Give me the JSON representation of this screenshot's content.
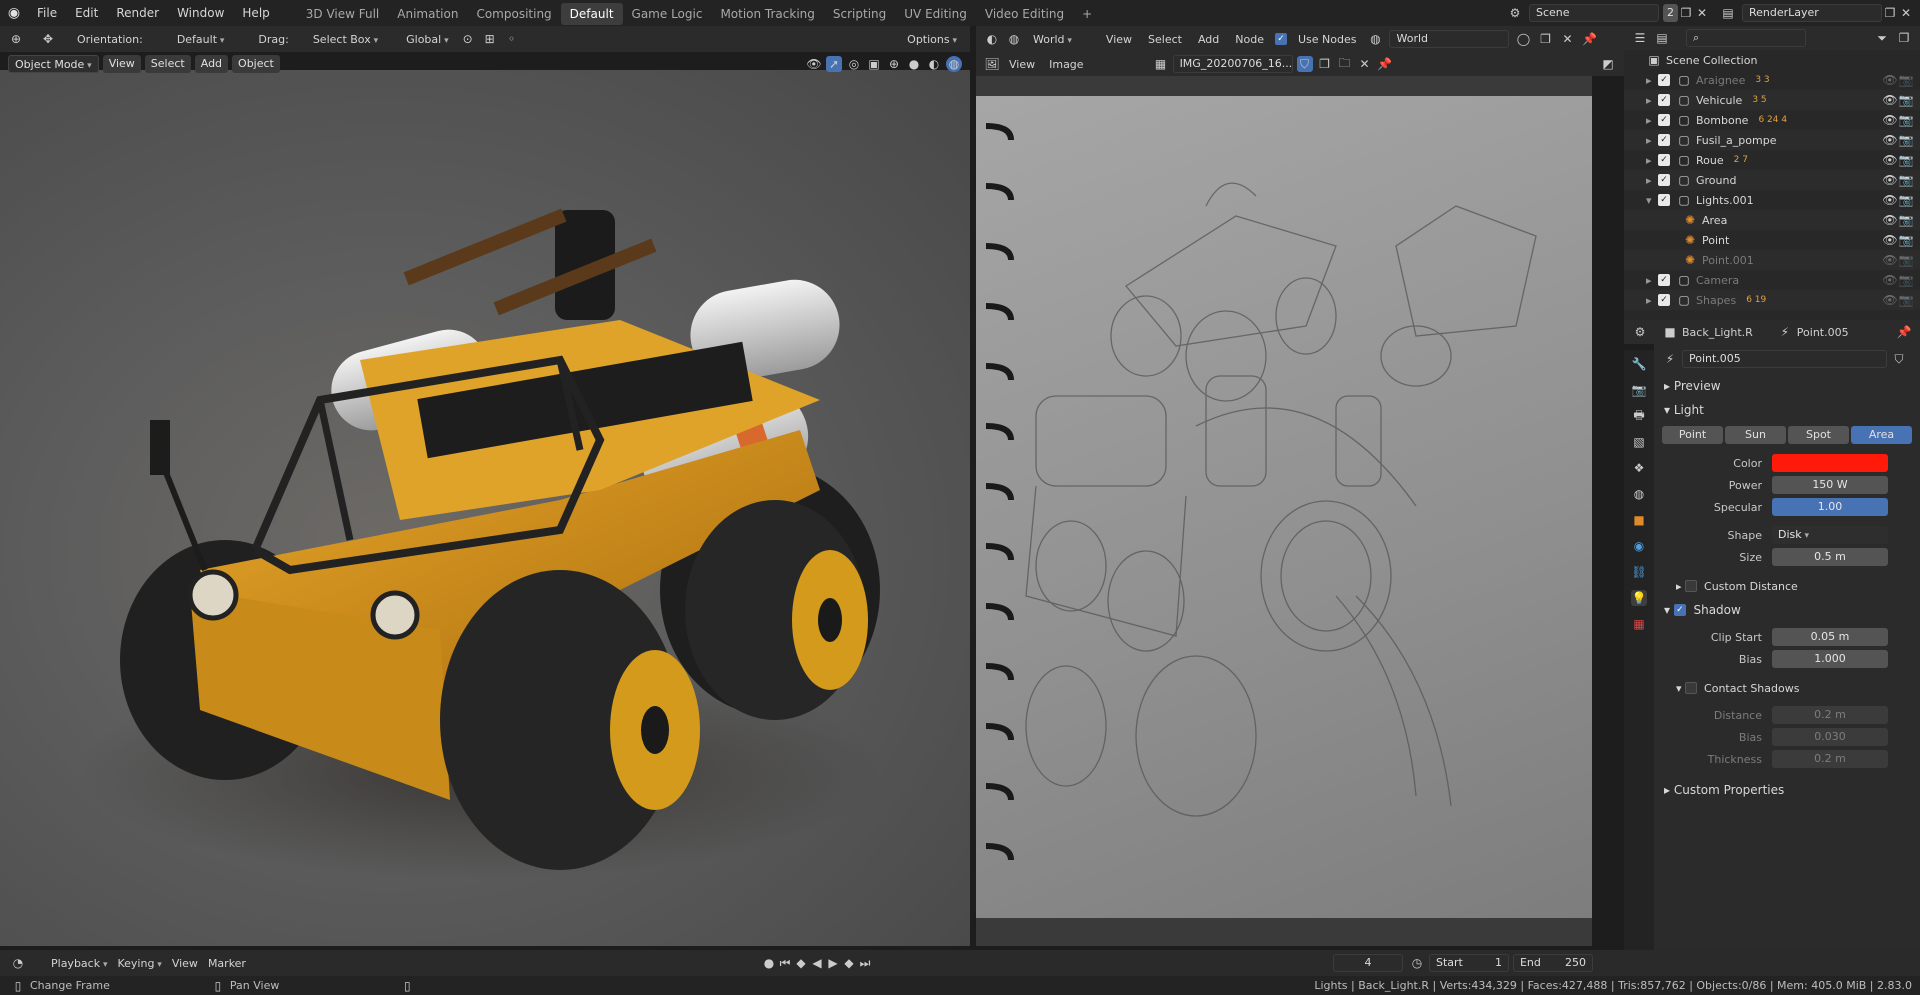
{
  "menu": [
    "File",
    "Edit",
    "Render",
    "Window",
    "Help"
  ],
  "workspaces": [
    "3D View Full",
    "Animation",
    "Compositing",
    "Default",
    "Game Logic",
    "Motion Tracking",
    "Scripting",
    "UV Editing",
    "Video Editing"
  ],
  "active_workspace": "Default",
  "scene": {
    "name": "Scene",
    "count": "2",
    "layer": "RenderLayer"
  },
  "viewport_header": {
    "orientation_label": "Orientation:",
    "orientation_value": "Default",
    "drag_label": "Drag:",
    "drag_value": "Select Box",
    "transform": "Global",
    "options": "Options",
    "mode": "Object Mode",
    "view": "View",
    "select": "Select",
    "add": "Add",
    "object": "Object"
  },
  "node_header": {
    "world": "World",
    "view": "View",
    "select": "Select",
    "add": "Add",
    "node": "Node",
    "use_nodes": "Use Nodes",
    "world_name": "World"
  },
  "image_editor": {
    "view": "View",
    "image": "Image",
    "image_name": "IMG_20200706_16..."
  },
  "outliner": {
    "root": "Scene Collection",
    "items": [
      {
        "name": "Araignee",
        "dim": true,
        "badges": "3 3"
      },
      {
        "name": "Vehicule",
        "dim": false,
        "badges": "3 5"
      },
      {
        "name": "Bombone",
        "dim": false,
        "badges": "6 24 4"
      },
      {
        "name": "Fusil_a_pompe",
        "dim": false,
        "badges": ""
      },
      {
        "name": "Roue",
        "dim": false,
        "badges": "2 7"
      },
      {
        "name": "Ground",
        "dim": false,
        "badges": ""
      },
      {
        "name": "Lights.001",
        "dim": false,
        "badges": ""
      },
      {
        "name": "Area",
        "dim": false,
        "child": true,
        "badges": ""
      },
      {
        "name": "Point",
        "dim": false,
        "child": true,
        "badges": ""
      },
      {
        "name": "Point.001",
        "dim": true,
        "child": true,
        "badges": ""
      },
      {
        "name": "Camera",
        "dim": true,
        "badges": ""
      },
      {
        "name": "Shapes",
        "dim": true,
        "badges": "6 19"
      }
    ]
  },
  "properties": {
    "object": "Back_Light.R",
    "data": "Point.005",
    "datablock": "Point.005",
    "preview": "Preview",
    "light_section": "Light",
    "light_types": [
      "Point",
      "Sun",
      "Spot",
      "Area"
    ],
    "active_type": "Area",
    "color_label": "Color",
    "color": "#ff1a0a",
    "power_label": "Power",
    "power": "150 W",
    "specular_label": "Specular",
    "specular": "1.00",
    "shape_label": "Shape",
    "shape": "Disk",
    "size_label": "Size",
    "size": "0.5 m",
    "custom_distance": "Custom Distance",
    "shadow": "Shadow",
    "clip_start_label": "Clip Start",
    "clip_start": "0.05 m",
    "bias_label": "Bias",
    "bias": "1.000",
    "contact_shadows": "Contact Shadows",
    "distance_label": "Distance",
    "distance": "0.2 m",
    "cbias_label": "Bias",
    "cbias": "0.030",
    "thickness_label": "Thickness",
    "thickness": "0.2 m",
    "custom_properties": "Custom Properties"
  },
  "timeline": {
    "playback": "Playback",
    "keying": "Keying",
    "view": "View",
    "marker": "Marker",
    "current_frame": "4",
    "start_label": "Start",
    "start": "1",
    "end_label": "End",
    "end": "250"
  },
  "status": {
    "left1": "Change Frame",
    "left2": "Pan View",
    "right": "Lights | Back_Light.R | Verts:434,329 | Faces:427,488 | Tris:857,762 | Objects:0/86 | Mem: 405.0 MiB | 2.83.0"
  }
}
